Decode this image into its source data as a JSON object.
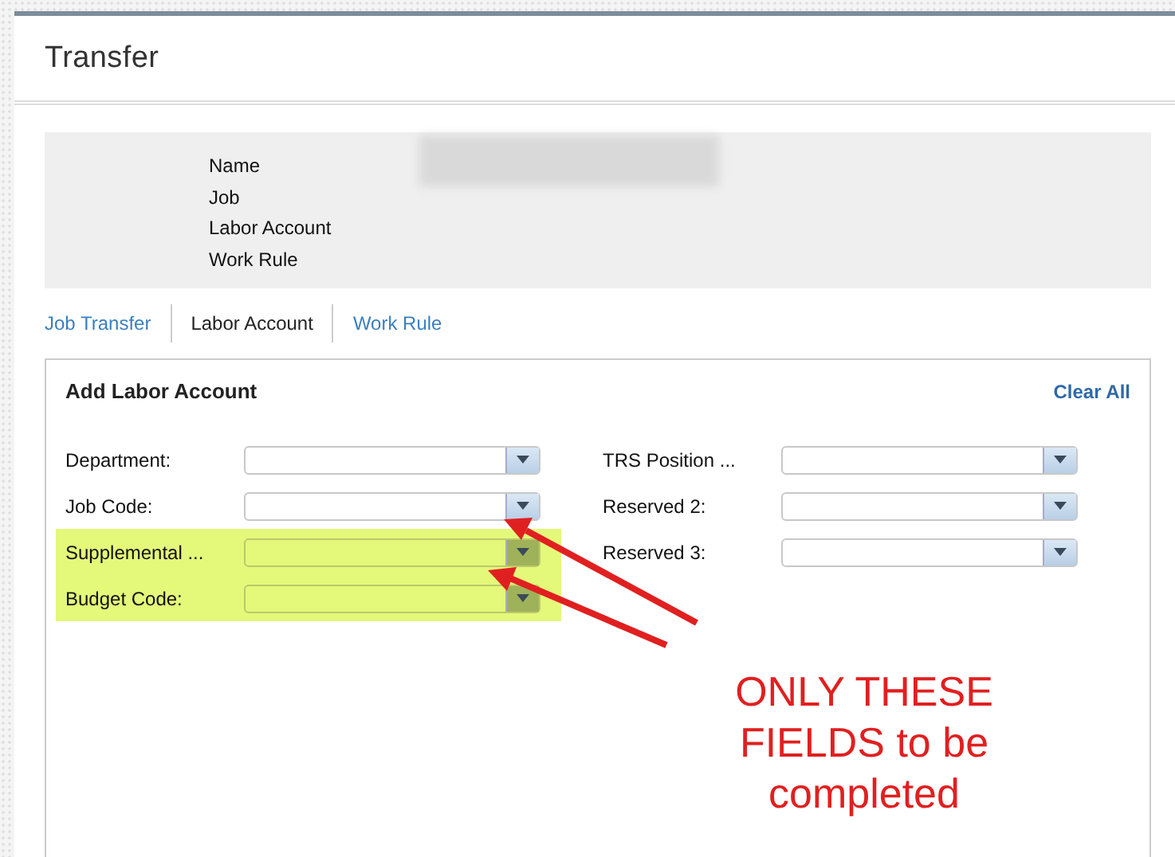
{
  "window": {
    "title": "Transfer"
  },
  "info": {
    "labels": [
      "Name",
      "Job",
      "Labor Account",
      "Work Rule"
    ]
  },
  "tabs": [
    {
      "label": "Job Transfer",
      "selected": false
    },
    {
      "label": "Labor Account",
      "selected": true
    },
    {
      "label": "Work Rule",
      "selected": false
    }
  ],
  "form": {
    "title": "Add Labor Account",
    "clear_link": "Clear All",
    "columns": [
      [
        {
          "label": "Department:",
          "highlighted": false
        },
        {
          "label": "Job Code:",
          "highlighted": false
        },
        {
          "label": "Supplemental ...",
          "highlighted": true
        },
        {
          "label": "Budget Code:",
          "highlighted": true
        }
      ],
      [
        {
          "label": "TRS Position ...",
          "highlighted": false
        },
        {
          "label": "Reserved 2:",
          "highlighted": false
        },
        {
          "label": "Reserved 3:",
          "highlighted": false
        }
      ]
    ]
  },
  "annotation": {
    "text": "ONLY THESE FIELDS to be completed"
  }
}
